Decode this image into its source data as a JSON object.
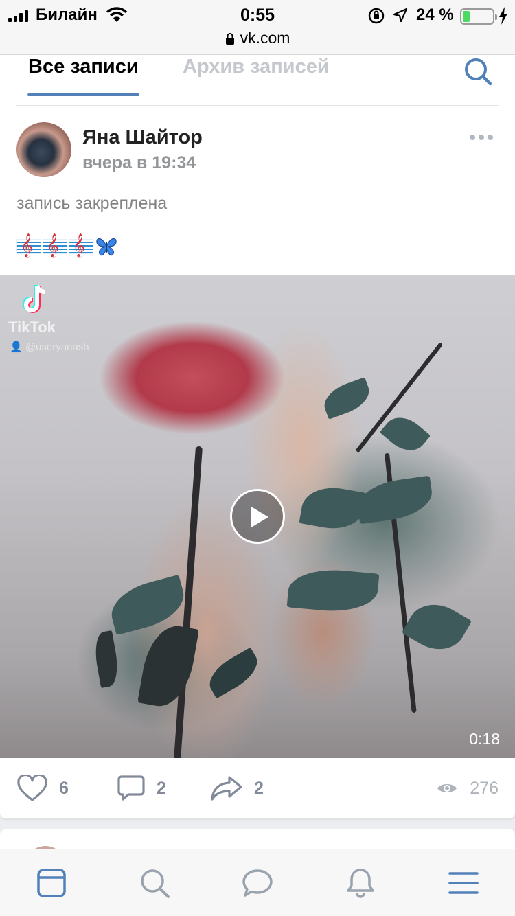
{
  "status_bar": {
    "carrier": "Билайн",
    "time": "0:55",
    "battery_percent_text": "24 %",
    "battery_level": 0.24,
    "url": "vk.com",
    "icons": [
      "signal-icon",
      "wifi-icon",
      "orientation-lock-icon",
      "location-icon",
      "battery-icon",
      "charging-icon",
      "lock-icon"
    ]
  },
  "tabs": {
    "all_posts": "Все записи",
    "archive": "Архив записей",
    "active": "all_posts"
  },
  "post": {
    "author": "Яна Шайтор",
    "time": "вчера в 19:34",
    "pinned_note": "запись закреплена",
    "emoji_line": [
      "🎼",
      "🎼",
      "🎼",
      "🦋"
    ],
    "video": {
      "tiktok_label": "TikTok",
      "tiktok_user": "@useryanash",
      "duration": "0:18"
    },
    "likes": "6",
    "comments": "2",
    "shares": "2",
    "views": "276"
  },
  "colors": {
    "accent": "#5181b8",
    "tab_inactive": "#c5c8cd",
    "meta_gray": "#939699",
    "action_gray": "#828a99"
  },
  "bottom_nav": [
    "news-icon",
    "search-icon",
    "messages-icon",
    "notifications-icon",
    "menu-icon"
  ]
}
